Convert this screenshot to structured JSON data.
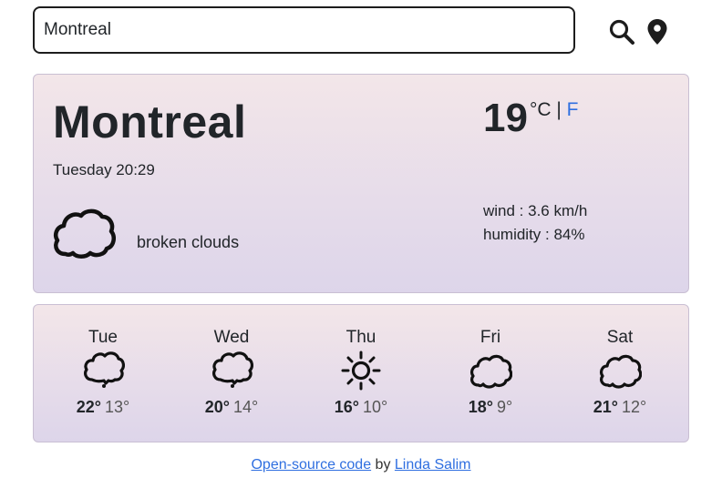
{
  "search": {
    "value": "Montreal",
    "search_icon": "search-icon",
    "location_icon": "map-pin-icon"
  },
  "current": {
    "city": "Montreal",
    "datetime": "Tuesday 20:29",
    "description": "broken clouds",
    "icon": "broken-clouds-icon",
    "temperature": "19",
    "unit_c": "°C",
    "unit_sep": " | ",
    "unit_f": "F",
    "wind": "wind : 3.6 km/h",
    "humidity": "humidity : 84%"
  },
  "forecast": [
    {
      "day": "Tue",
      "icon": "cloud-icon",
      "max": "22°",
      "min": "13°"
    },
    {
      "day": "Wed",
      "icon": "cloud-icon",
      "max": "20°",
      "min": "14°"
    },
    {
      "day": "Thu",
      "icon": "sun-icon",
      "max": "16°",
      "min": "10°"
    },
    {
      "day": "Fri",
      "icon": "broken-clouds-icon",
      "max": "18°",
      "min": "9°"
    },
    {
      "day": "Sat",
      "icon": "broken-clouds-icon",
      "max": "21°",
      "min": "12°"
    }
  ],
  "footer": {
    "source_link": "Open-source code",
    "by": " by ",
    "author_link": "Linda Salim"
  },
  "colors": {
    "accent": "#2f6fe0",
    "card_top": "#f3e6e9",
    "card_bottom": "#ddd5ea"
  }
}
